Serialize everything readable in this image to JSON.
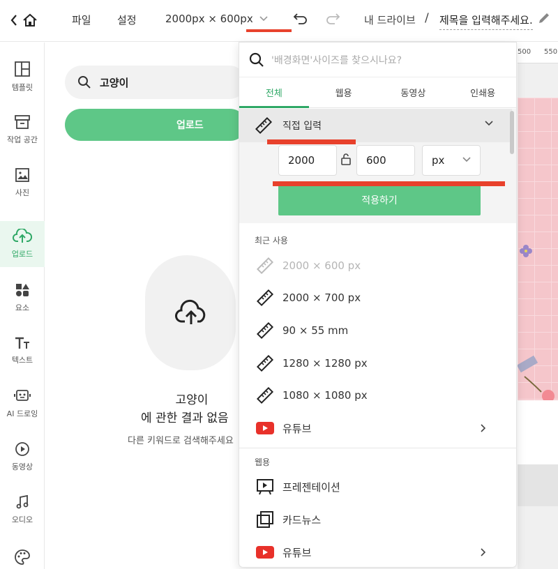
{
  "topbar": {
    "file_label": "파일",
    "settings_label": "설정",
    "size_label": "2000px × 600px",
    "drive_label": "내 드라이브",
    "separator": "/",
    "title": "제목을 입력해주세요."
  },
  "sidebar": {
    "items": [
      {
        "label": "템플릿",
        "icon": "template-icon"
      },
      {
        "label": "작업 공간",
        "icon": "workspace-icon"
      },
      {
        "label": "사진",
        "icon": "photo-icon"
      },
      {
        "label": "업로드",
        "icon": "upload-cloud-icon",
        "active": true
      },
      {
        "label": "요소",
        "icon": "elements-icon"
      },
      {
        "label": "텍스트",
        "icon": "text-icon"
      },
      {
        "label": "AI 드로잉",
        "icon": "ai-drawing-icon"
      },
      {
        "label": "동영상",
        "icon": "video-icon"
      },
      {
        "label": "오디오",
        "icon": "audio-icon"
      },
      {
        "label": "",
        "icon": "palette-icon"
      }
    ]
  },
  "panel": {
    "search_value": "고양이",
    "upload_label": "업로드",
    "no_result_keyword": "고양이",
    "no_result_text": "에 관한 결과 없음",
    "no_result_hint": "다른 키워드로 검색해주세요"
  },
  "ruler": {
    "ticks": [
      "500",
      "550"
    ]
  },
  "dropdown": {
    "search_placeholder": "'배경화면'사이즈를 찾으시나요?",
    "tabs": [
      "전체",
      "웹용",
      "동영상",
      "인쇄용"
    ],
    "direct_input_label": "직접 입력",
    "width_value": "2000",
    "height_value": "600",
    "unit_value": "px",
    "apply_label": "적용하기",
    "recent_label": "최근 사용",
    "recent_items": [
      "2000 × 600 px",
      "2000 × 700 px",
      "90 × 55 mm",
      "1280 × 1280 px",
      "1080 × 1080 px"
    ],
    "youtube_label": "유튜브",
    "web_label": "웹용",
    "web_items": [
      "프레젠테이션",
      "카드뉴스",
      "유튜브"
    ]
  },
  "colors": {
    "accent_green": "#5ec787",
    "annotation_red": "#e8412c",
    "youtube_red": "#e8312a",
    "canvas_pink": "#f5c6cb"
  }
}
